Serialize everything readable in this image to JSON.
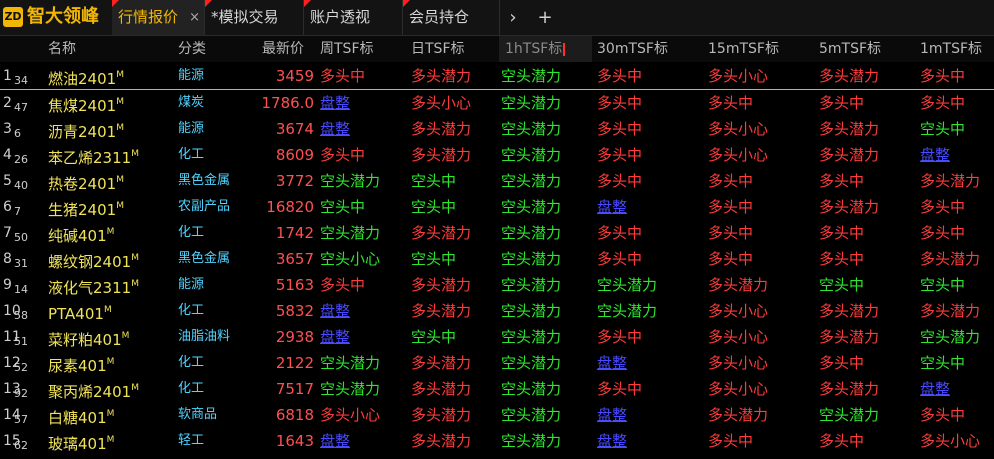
{
  "logo": {
    "badge": "ZD",
    "text": "智大领峰"
  },
  "tabs": [
    {
      "label": "行情报价",
      "active": true,
      "closable": true,
      "close_icon": "×"
    },
    {
      "label": "*模拟交易",
      "active": false
    },
    {
      "label": "账户透视",
      "active": false
    },
    {
      "label": "会员持仓",
      "active": false
    }
  ],
  "tab_controls": {
    "next_icon": "›",
    "add_icon": "+"
  },
  "columns": [
    "名称",
    "分类",
    "最新价",
    "周TSF标",
    "日TSF标",
    "1hTSF标",
    "30mTSF标",
    "15mTSF标",
    "5mTSF标",
    "1mTSF标"
  ],
  "active_column": "1hTSF标",
  "colors": {
    "long": "#ff3b3b",
    "short": "#2ee62e",
    "flat": "#4a4aff",
    "name": "#f0e35a",
    "category": "#4fd3ff"
  },
  "signal_colors": {
    "多头中": "long",
    "多头潜力": "long",
    "多头小心": "long",
    "空头中": "short",
    "空头潜力": "short",
    "空头小心": "short",
    "盘整": "flat"
  },
  "rows": [
    {
      "idx": "1",
      "sub": "34",
      "name": "燃油2401",
      "sup": "M",
      "category": "能源",
      "price": "3459",
      "signals": [
        "多头中",
        "多头潜力",
        "空头潜力",
        "多头中",
        "多头小心",
        "多头潜力",
        "多头中"
      ]
    },
    {
      "idx": "2",
      "sub": "47",
      "name": "焦煤2401",
      "sup": "M",
      "category": "煤炭",
      "price": "1786.0",
      "signals": [
        "盘整",
        "多头小心",
        "空头潜力",
        "多头中",
        "多头中",
        "多头中",
        "多头中"
      ]
    },
    {
      "idx": "3",
      "sub": "6",
      "name": "沥青2401",
      "sup": "M",
      "category": "能源",
      "price": "3674",
      "signals": [
        "盘整",
        "多头潜力",
        "空头潜力",
        "多头中",
        "多头小心",
        "多头潜力",
        "空头中"
      ]
    },
    {
      "idx": "4",
      "sub": "26",
      "name": "苯乙烯2311",
      "sup": "M",
      "category": "化工",
      "price": "8609",
      "signals": [
        "多头中",
        "多头潜力",
        "空头潜力",
        "多头中",
        "多头小心",
        "多头潜力",
        "盘整"
      ]
    },
    {
      "idx": "5",
      "sub": "40",
      "name": "热卷2401",
      "sup": "M",
      "category": "黑色金属",
      "price": "3772",
      "signals": [
        "空头潜力",
        "空头中",
        "空头潜力",
        "多头中",
        "多头中",
        "多头中",
        "多头潜力"
      ]
    },
    {
      "idx": "6",
      "sub": "7",
      "name": "生猪2401",
      "sup": "M",
      "category": "农副产品",
      "price": "16820",
      "signals": [
        "空头中",
        "空头中",
        "空头潜力",
        "盘整",
        "多头中",
        "多头潜力",
        "多头中"
      ]
    },
    {
      "idx": "7",
      "sub": "50",
      "name": "纯碱401",
      "sup": "M",
      "category": "化工",
      "price": "1742",
      "signals": [
        "空头潜力",
        "多头潜力",
        "空头潜力",
        "多头中",
        "多头中",
        "多头中",
        "多头中"
      ]
    },
    {
      "idx": "8",
      "sub": "31",
      "name": "螺纹钢2401",
      "sup": "M",
      "category": "黑色金属",
      "price": "3657",
      "signals": [
        "空头小心",
        "空头中",
        "空头潜力",
        "多头中",
        "多头中",
        "多头中",
        "多头潜力"
      ]
    },
    {
      "idx": "9",
      "sub": "14",
      "name": "液化气2311",
      "sup": "M",
      "category": "能源",
      "price": "5163",
      "signals": [
        "多头中",
        "多头潜力",
        "空头潜力",
        "空头潜力",
        "多头潜力",
        "空头中",
        "空头中"
      ]
    },
    {
      "idx": "10",
      "sub": "58",
      "name": "PTA401",
      "sup": "M",
      "category": "化工",
      "price": "5832",
      "signals": [
        "盘整",
        "多头潜力",
        "空头潜力",
        "空头潜力",
        "多头小心",
        "多头潜力",
        "多头潜力"
      ]
    },
    {
      "idx": "11",
      "sub": "51",
      "name": "菜籽粕401",
      "sup": "M",
      "category": "油脂油料",
      "price": "2938",
      "signals": [
        "盘整",
        "空头中",
        "空头潜力",
        "多头中",
        "多头小心",
        "多头潜力",
        "空头潜力"
      ]
    },
    {
      "idx": "12",
      "sub": "52",
      "name": "尿素401",
      "sup": "M",
      "category": "化工",
      "price": "2122",
      "signals": [
        "空头潜力",
        "多头潜力",
        "空头潜力",
        "盘整",
        "多头小心",
        "多头中",
        "空头中"
      ]
    },
    {
      "idx": "13",
      "sub": "92",
      "name": "聚丙烯2401",
      "sup": "M",
      "category": "化工",
      "price": "7517",
      "signals": [
        "空头潜力",
        "多头潜力",
        "空头潜力",
        "多头中",
        "多头小心",
        "多头潜力",
        "盘整"
      ]
    },
    {
      "idx": "14",
      "sub": "57",
      "name": "白糖401",
      "sup": "M",
      "category": "软商品",
      "price": "6818",
      "signals": [
        "多头小心",
        "多头潜力",
        "空头潜力",
        "盘整",
        "多头潜力",
        "空头潜力",
        "多头中"
      ]
    },
    {
      "idx": "15",
      "sub": "62",
      "name": "玻璃401",
      "sup": "M",
      "category": "轻工",
      "price": "1643",
      "signals": [
        "盘整",
        "多头潜力",
        "空头潜力",
        "盘整",
        "多头中",
        "多头中",
        "多头小心"
      ]
    }
  ]
}
